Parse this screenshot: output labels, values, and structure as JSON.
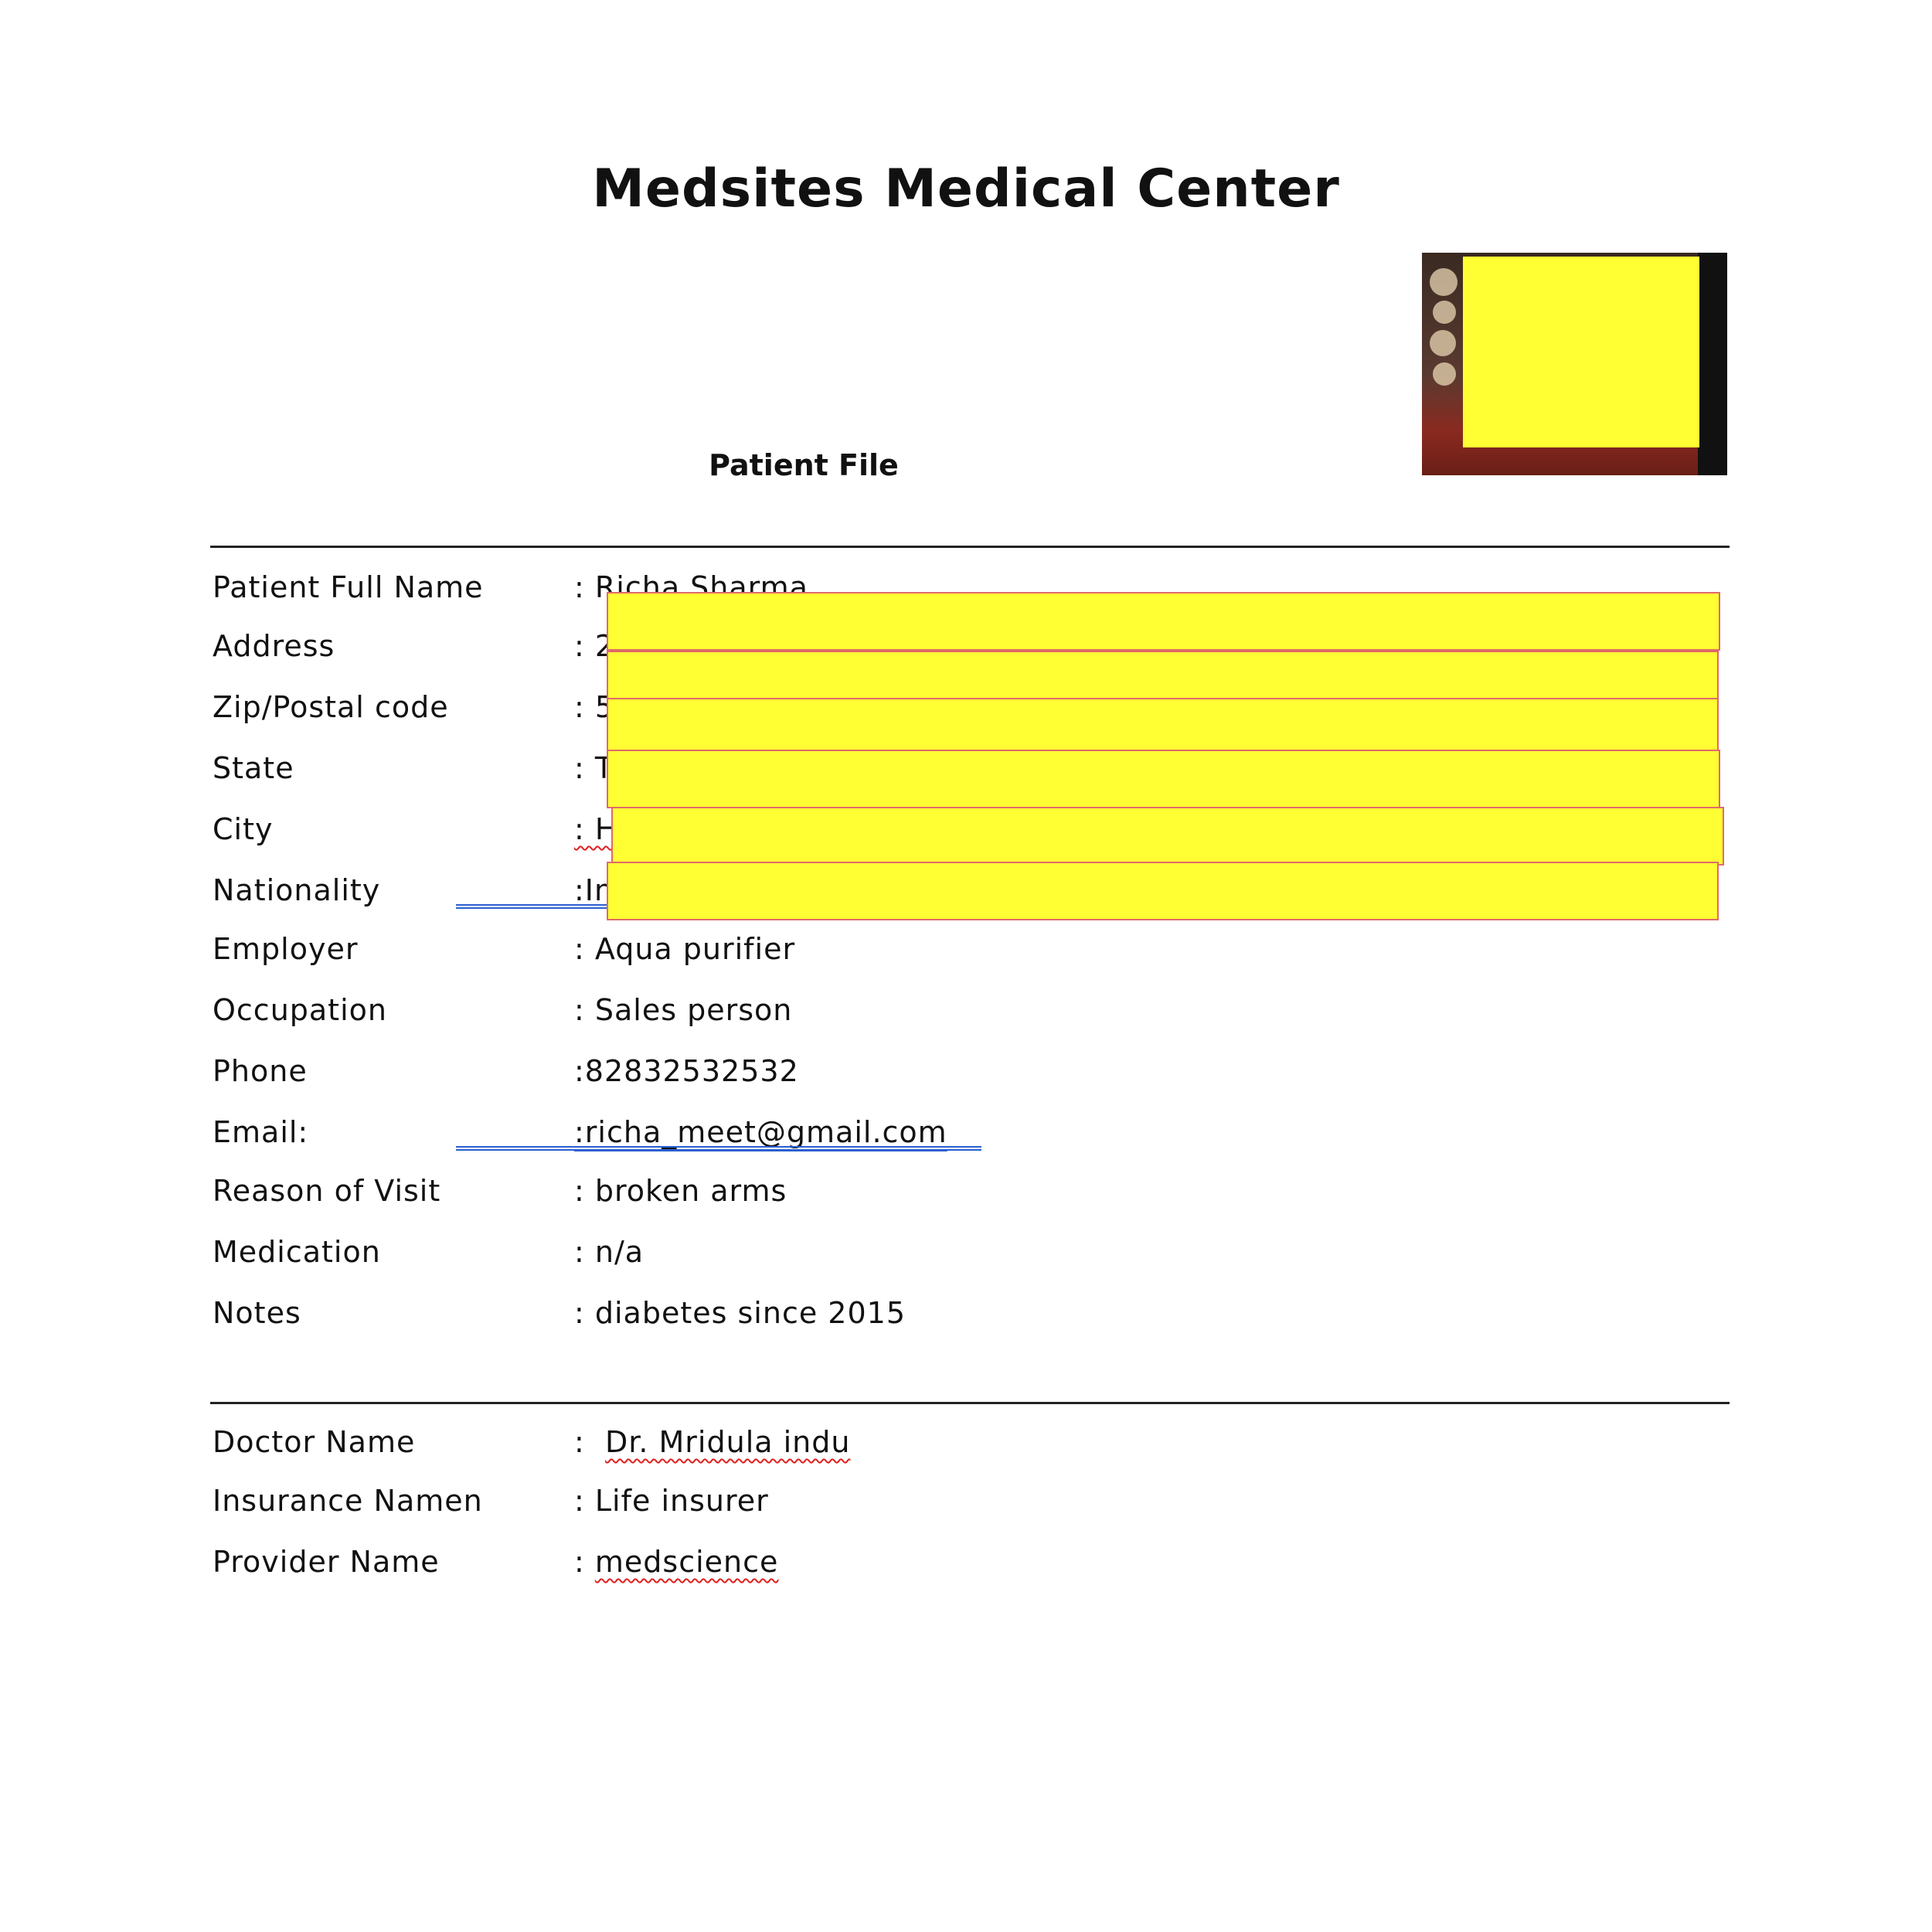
{
  "header": {
    "title": "Medsites Medical Center",
    "subtitle": "Patient File"
  },
  "patient": {
    "fields": [
      {
        "label": "Patient Full Name",
        "value": ":  Richa Sharma"
      },
      {
        "label": "Address",
        "value": ": 2"
      },
      {
        "label": "Zip/Postal code",
        "value": ": 5"
      },
      {
        "label": "State",
        "value": ": T"
      },
      {
        "label": "City",
        "value": ": H"
      },
      {
        "label": "Nationality",
        "value": ":In"
      },
      {
        "label": "Employer",
        "value": ": Aqua purifier"
      },
      {
        "label": "Occupation",
        "value": ": Sales person"
      },
      {
        "label": "Phone",
        "value": ":82832532532"
      },
      {
        "label": "Email:",
        "value": ":richa_meet@gmail.com"
      },
      {
        "label": "Reason of Visit",
        "value": ": broken arms"
      },
      {
        "label": "Medication",
        "value": ": n/a"
      },
      {
        "label": "Notes",
        "value": ": diabetes since 2015"
      }
    ]
  },
  "provider": {
    "fields": [
      {
        "label": "Doctor Name",
        "prefix": ":  ",
        "value": "Dr. Mridula indu"
      },
      {
        "label": "Insurance Namen",
        "prefix": ": ",
        "value": "Life insurer"
      },
      {
        "label": "Provider Name",
        "prefix": ": ",
        "value": "medscience"
      }
    ]
  },
  "colors": {
    "redaction": "#ffff33",
    "redaction_border": "#e06a6a",
    "hyperlink_underline": "#2a5fd0",
    "spellcheck": "#e02020"
  }
}
